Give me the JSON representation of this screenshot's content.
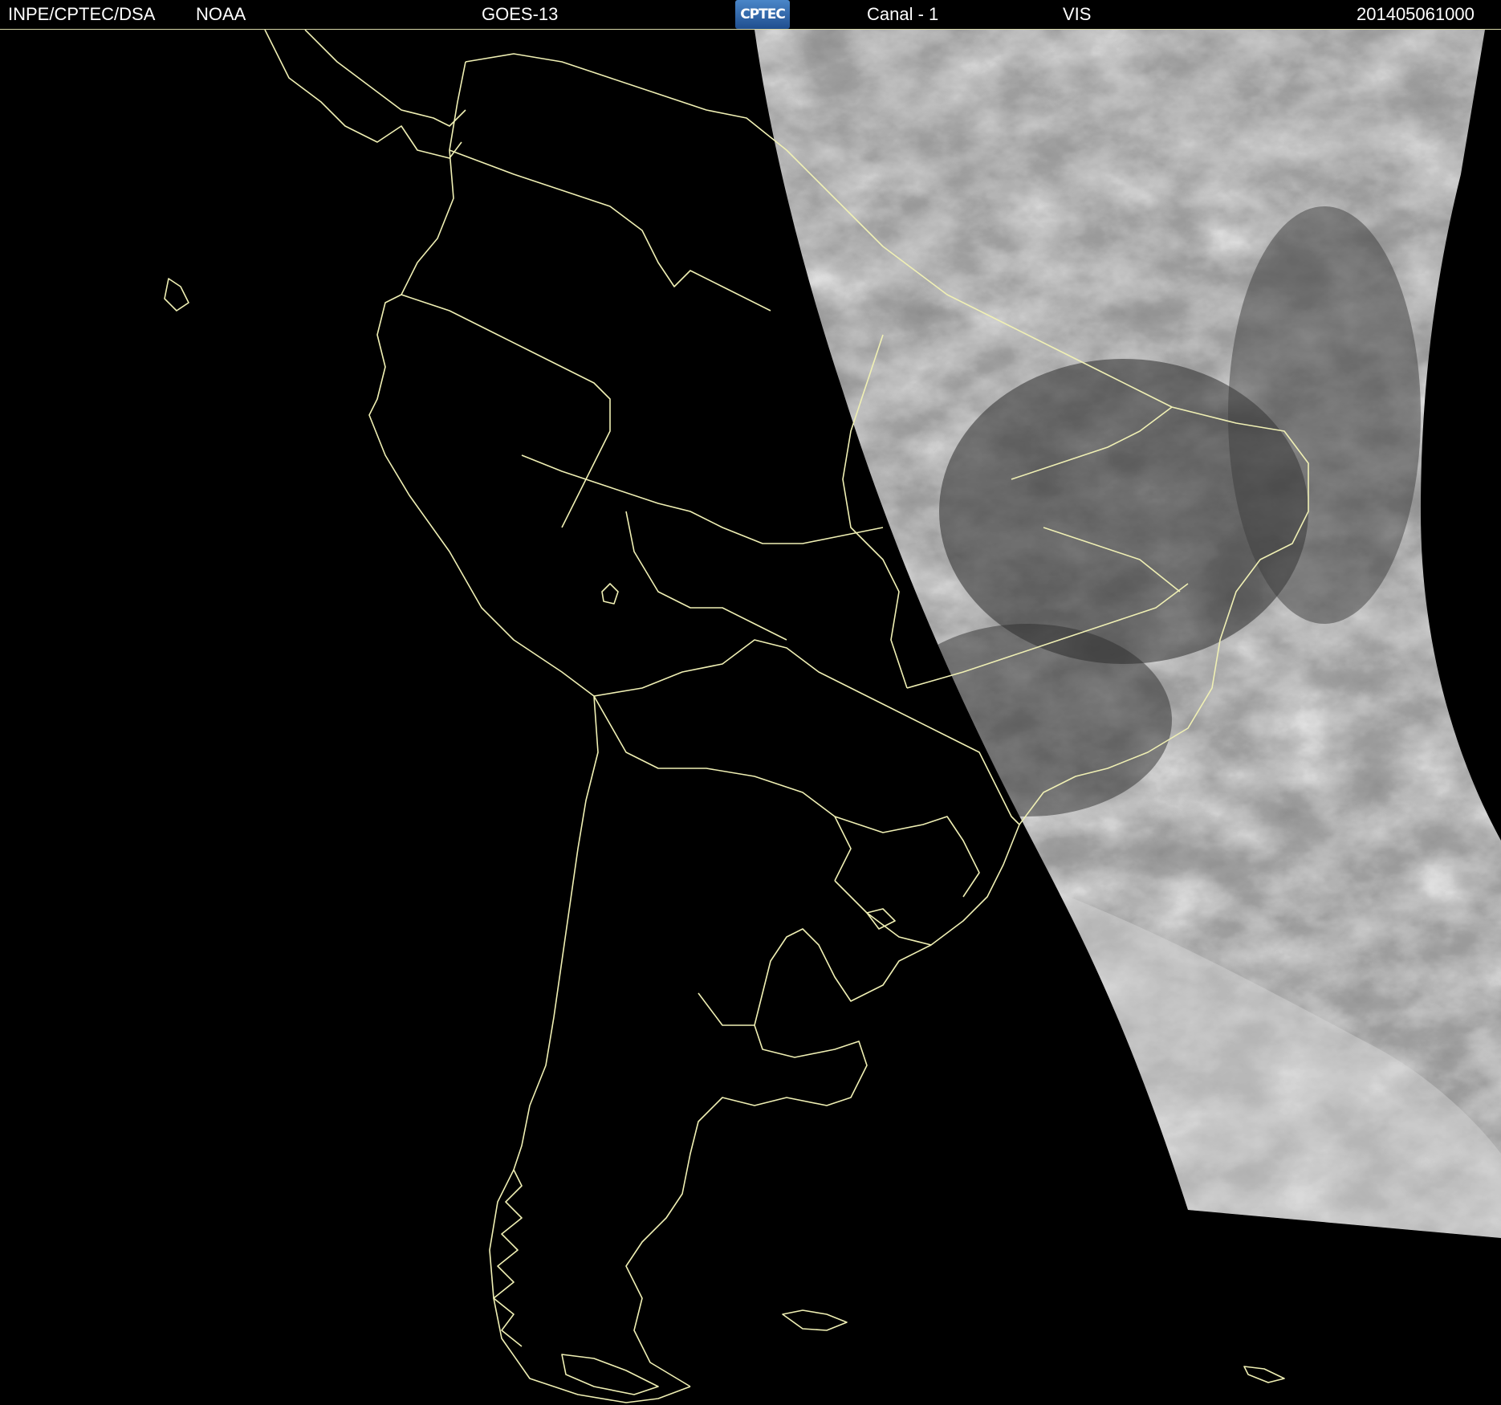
{
  "header": {
    "institution": "INPE/CPTEC/DSA",
    "agency": "NOAA",
    "satellite": "GOES-13",
    "logo_text": "CPTEC",
    "channel": "Canal - 1",
    "band": "VIS",
    "timestamp": "201405061000"
  },
  "map": {
    "border_color": "#f0f0b4",
    "night_color": "#000000",
    "cloud_colors": [
      "#3a3a3a",
      "#5a5a5a",
      "#8a8a8a",
      "#c8c8c8"
    ]
  }
}
